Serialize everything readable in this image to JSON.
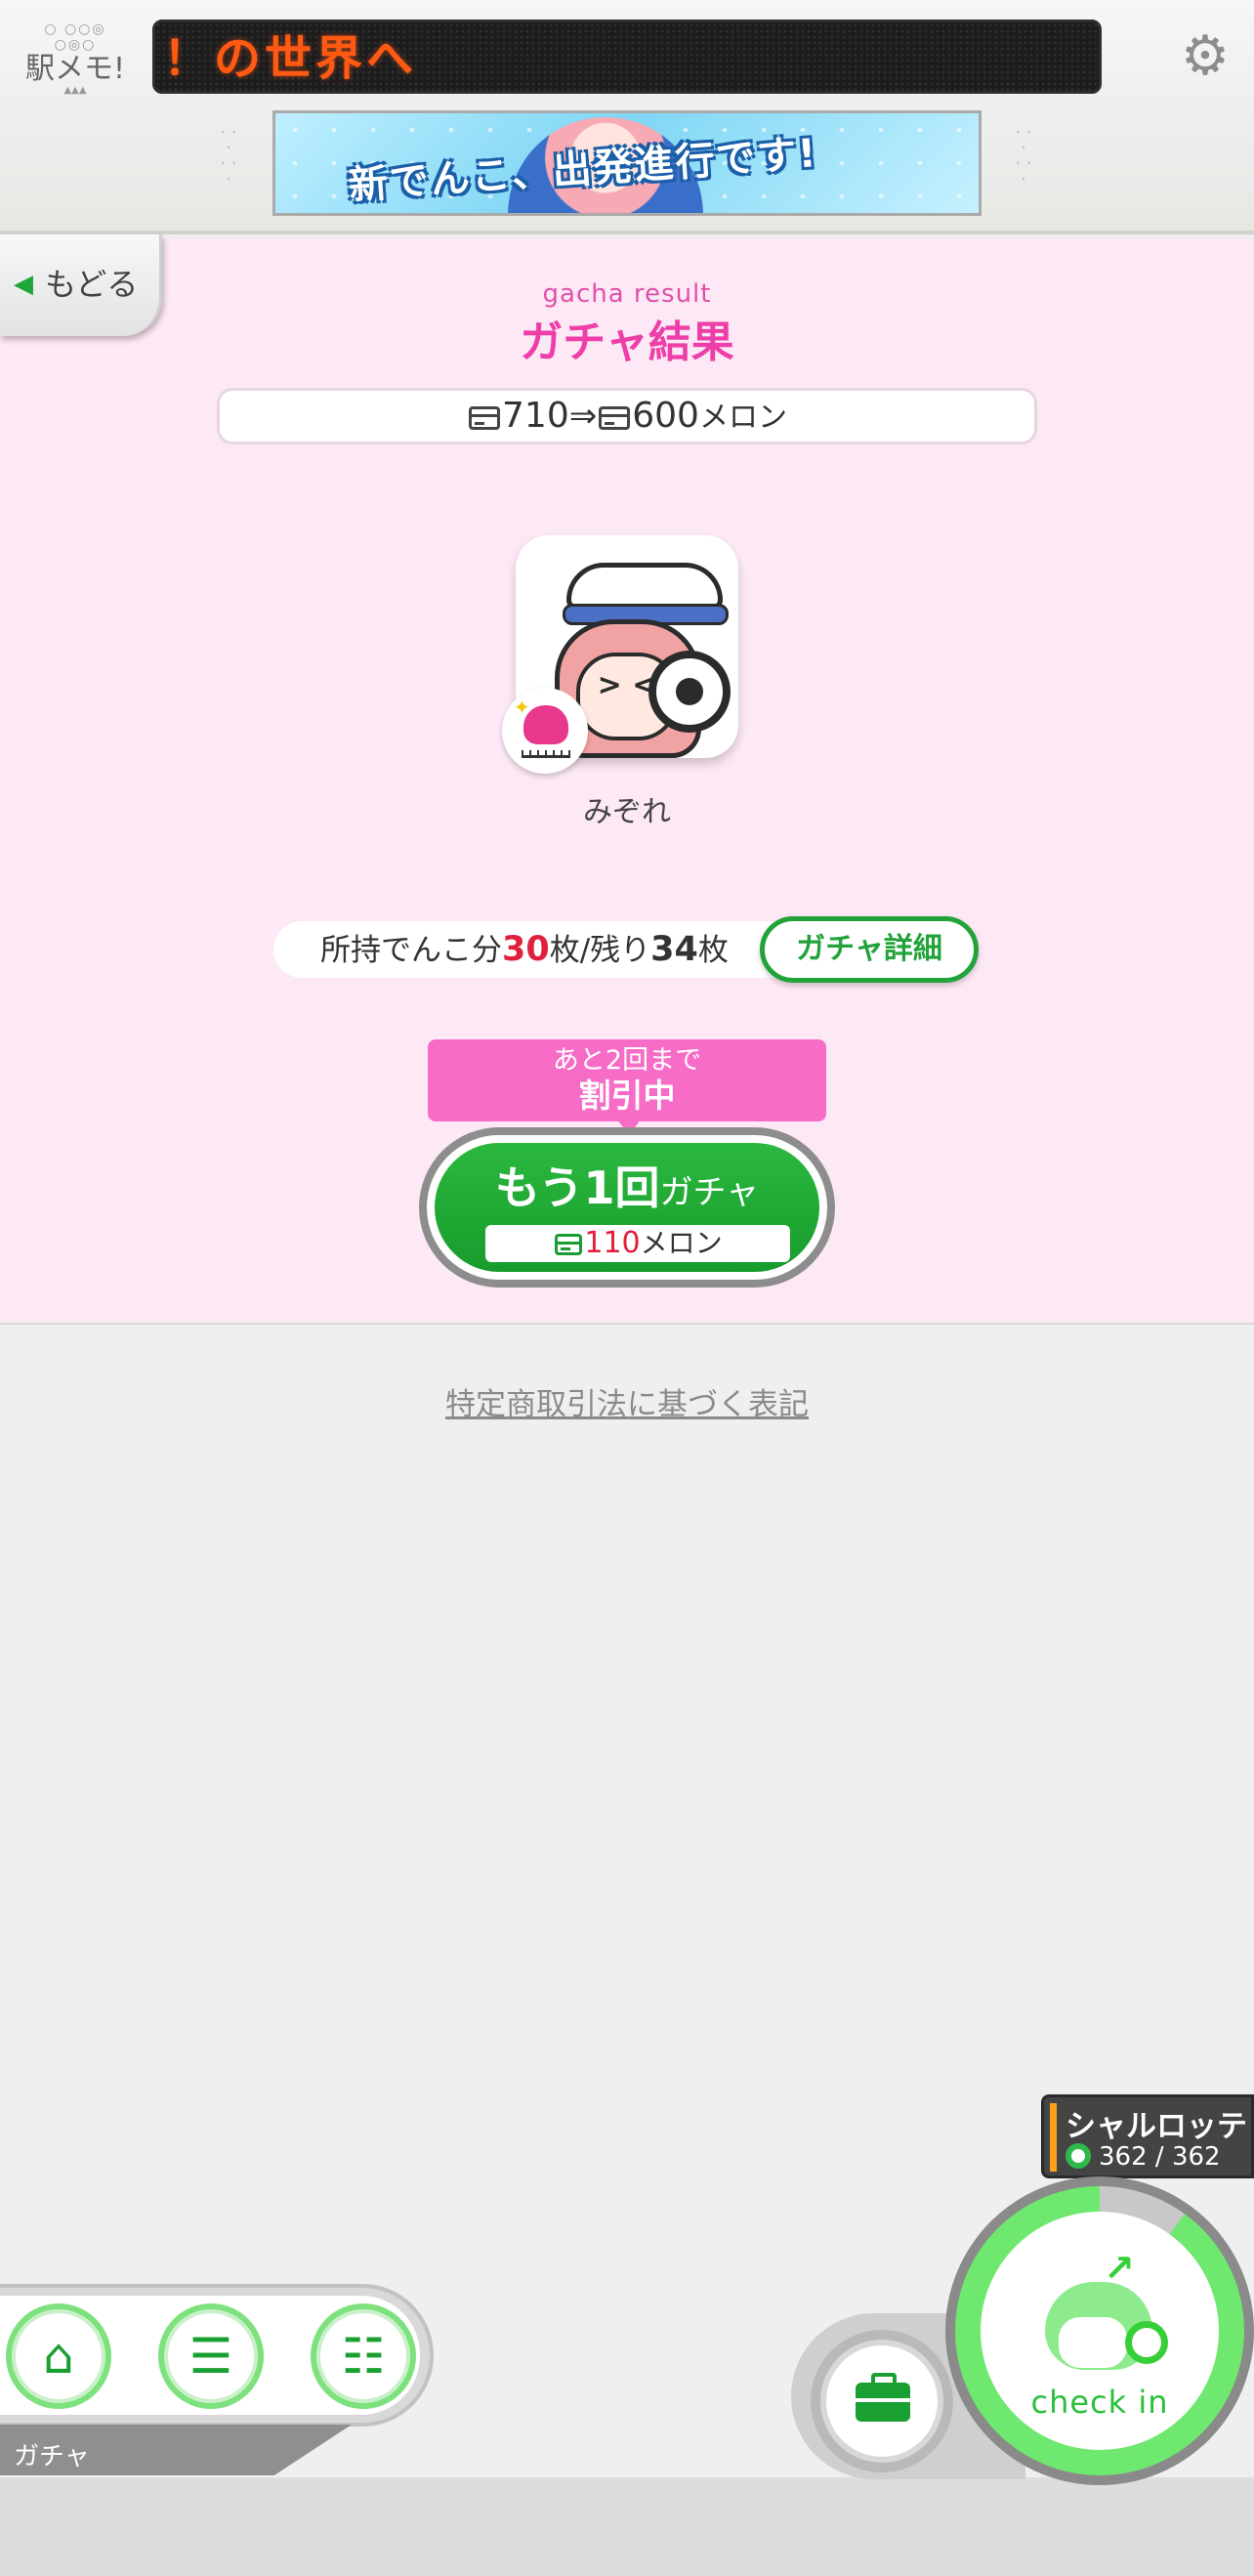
{
  "header": {
    "logo_dots": "○ ○○◎ ○◎○",
    "logo_name": "駅メモ!",
    "logo_tri": "▲▲▲",
    "led_text": "！の世界へ",
    "settings_icon": "gear-icon",
    "banner": {
      "slogan": "新でんこ、出発進行です!"
    }
  },
  "back": {
    "label": "もどる",
    "icon": "left-triangle-icon"
  },
  "result": {
    "subtitle": "gacha result",
    "title": "ガチャ結果"
  },
  "balance": {
    "before": "710",
    "arrow": "⇒",
    "after": "600",
    "unit": "メロン",
    "icon": "card-icon"
  },
  "prize": {
    "name": "みぞれ",
    "face_expr": "> <"
  },
  "denko_info": {
    "prefix": "所持でんこ分",
    "owned": "30",
    "mid": "枚/残り",
    "remaining": "34",
    "suffix": "枚"
  },
  "detail_button": {
    "label": "ガチャ詳細"
  },
  "discount": {
    "line1": "あと2回まで",
    "line2": "割引中"
  },
  "again_button": {
    "big": "もう1回",
    "small": "ガチャ",
    "price": "110",
    "unit": "メロン"
  },
  "legal_link": "特定商取引法に基づく表記",
  "nav": {
    "items": [
      {
        "name": "home",
        "icon": "home-icon"
      },
      {
        "name": "denko-list",
        "icon": "denko-list-icon"
      },
      {
        "name": "station-list",
        "icon": "station-list-icon"
      }
    ],
    "current_label": "ガチャ"
  },
  "partner": {
    "name": "シャルロッテ",
    "hp_current": "362",
    "hp_sep": " / ",
    "hp_max": "362"
  },
  "checkin": {
    "label": "check in"
  },
  "colors": {
    "accent_green": "#1aa032",
    "pink_title": "#ee3ea8",
    "discount_pink": "#f76cc6",
    "highlight_red": "#e0203c",
    "led_orange": "#ff5a14"
  }
}
